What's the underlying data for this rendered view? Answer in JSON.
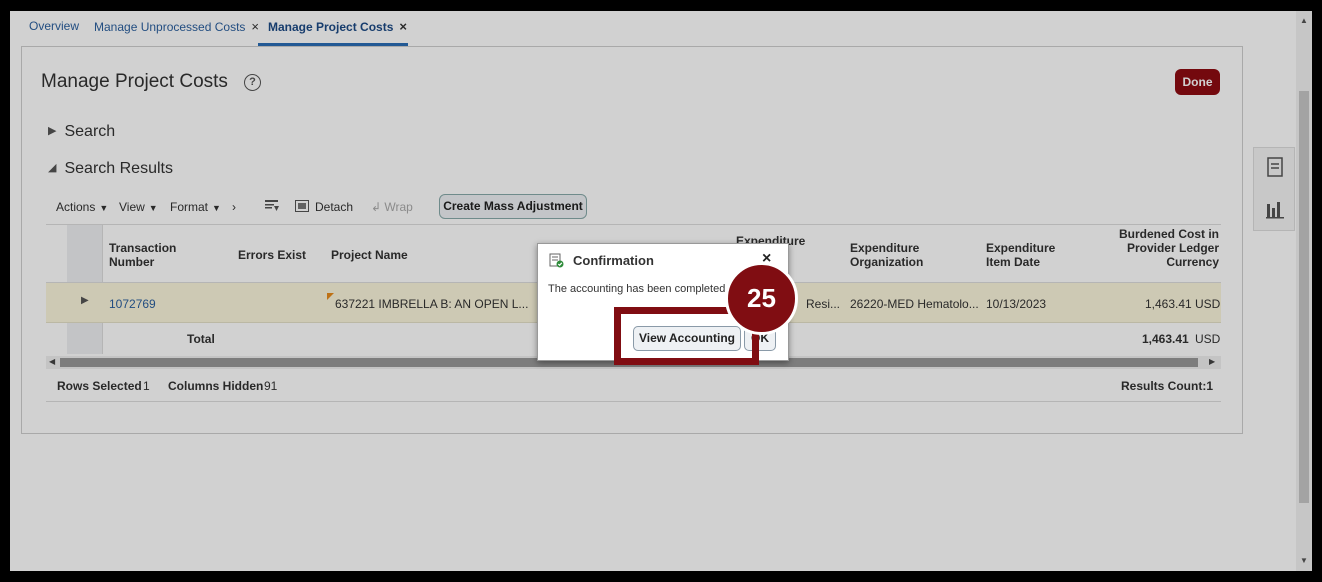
{
  "tabs": [
    {
      "label": "Overview",
      "closable": false,
      "active": false
    },
    {
      "label": "Manage Unprocessed Costs",
      "closable": true,
      "active": false
    },
    {
      "label": "Manage Project Costs",
      "closable": true,
      "active": true
    }
  ],
  "page": {
    "title": "Manage Project Costs",
    "help_symbol": "?",
    "done_label": "Done"
  },
  "sections": {
    "search_label": "Search",
    "results_label": "Search Results"
  },
  "toolbar": {
    "actions": "Actions",
    "view": "View",
    "format": "Format",
    "detach": "Detach",
    "wrap": "Wrap",
    "create_mass_adjustment": "Create Mass Adjustment"
  },
  "table": {
    "headers": {
      "transaction_number": "Transaction Number",
      "errors_exist": "Errors Exist",
      "project_name": "Project Name",
      "expenditure_type": "Expenditure",
      "expenditure_organization": "Expenditure Organization",
      "expenditure_item_date": "Expenditure Item Date",
      "burdened_cost": "Burdened Cost in Provider Ledger Currency"
    },
    "row": {
      "transaction_number": "1072769",
      "project_name": "637221 IMBRELLA B: AN OPEN L...",
      "expenditure_type": "Resi...",
      "expenditure_organization": "26220-MED Hematolo...",
      "expenditure_item_date": "10/13/2023",
      "burdened_cost": "1,463.41",
      "currency": "USD"
    },
    "total": {
      "label": "Total",
      "amount": "1,463.41",
      "currency": "USD"
    },
    "footer": {
      "rows_selected_label": "Rows Selected",
      "rows_selected_value": "1",
      "columns_hidden_label": "Columns Hidden",
      "columns_hidden_value": "91",
      "results_count": "Results Count:1"
    }
  },
  "dialog": {
    "title": "Confirmation",
    "message": "The accounting has been completed.",
    "close_symbol": "×",
    "view_accounting_label": "View Accounting",
    "ok_label": "OK"
  },
  "annotation": {
    "step_number": "25"
  },
  "colors": {
    "accent": "#800d12",
    "link": "#2a5f9e",
    "row_highlight": "#fbf6dc"
  }
}
